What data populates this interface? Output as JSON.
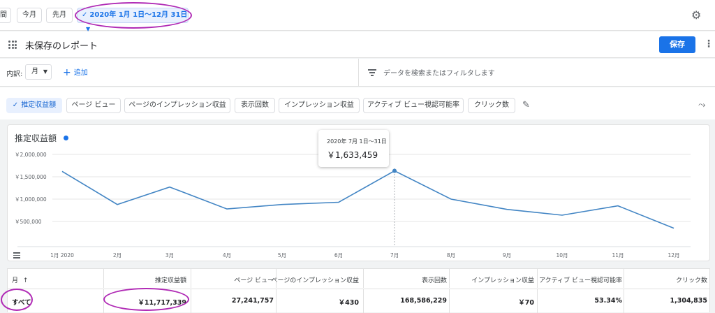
{
  "toolbar": {
    "partial_label": "間",
    "this_month": "今月",
    "last_month": "先月",
    "date_range": "2020年 1月 1日〜12月 31日",
    "check_icon": "check-icon",
    "dropdown_icon": "triangle-down-icon",
    "settings_icon": "gear-icon"
  },
  "report": {
    "title": "未保存のレポート",
    "save_label": "保存"
  },
  "filters": {
    "breakdown_label": "内訳:",
    "breakdown_value": "月",
    "add_label": "追加",
    "search_placeholder": "データを検索またはフィルタします"
  },
  "metrics": [
    {
      "label": "推定収益額",
      "selected": true
    },
    {
      "label": "ページ ビュー",
      "selected": false
    },
    {
      "label": "ページのインプレッション収益",
      "selected": false
    },
    {
      "label": "表示回数",
      "selected": false
    },
    {
      "label": "インプレッション収益",
      "selected": false
    },
    {
      "label": "アクティブ ビュー視認可能率",
      "selected": false
    },
    {
      "label": "クリック数",
      "selected": false
    }
  ],
  "chart_title": "推定収益額",
  "tooltip": {
    "date": "2020年 7月 1日〜31日",
    "value": "￥1,633,459"
  },
  "chart_data": {
    "type": "line",
    "title": "推定収益額",
    "categories": [
      "1月 2020",
      "2月",
      "3月",
      "4月",
      "5月",
      "6月",
      "7月",
      "8月",
      "9月",
      "10月",
      "11月",
      "12月"
    ],
    "series": [
      {
        "name": "推定収益額",
        "values": [
          1620000,
          880000,
          1270000,
          780000,
          880000,
          930000,
          1633459,
          1000000,
          770000,
          640000,
          850000,
          350000
        ]
      }
    ],
    "y_ticks": [
      "￥2,000,000",
      "￥1,500,000",
      "￥1,000,000",
      "￥500,000"
    ],
    "y_tick_values": [
      2000000,
      1500000,
      1000000,
      500000
    ],
    "ylim": [
      0,
      2000000
    ],
    "color": "#4285c4",
    "grid": true,
    "highlight_index": 6
  },
  "table": {
    "headers": [
      "月",
      "推定収益額",
      "ページ ビュー",
      "ページのインプレッション収益",
      "表示回数",
      "インプレッション収益",
      "アクティブ ビュー視認可能率",
      "クリック数"
    ],
    "sort_icon": "arrow-up-icon",
    "total_row": [
      "すべて",
      "￥11,717,339",
      "27,241,757",
      "￥430",
      "168,586,229",
      "￥70",
      "53.34%",
      "1,304,835"
    ]
  },
  "accent": "#1a73e8",
  "annotation_color": "#b02ab5"
}
